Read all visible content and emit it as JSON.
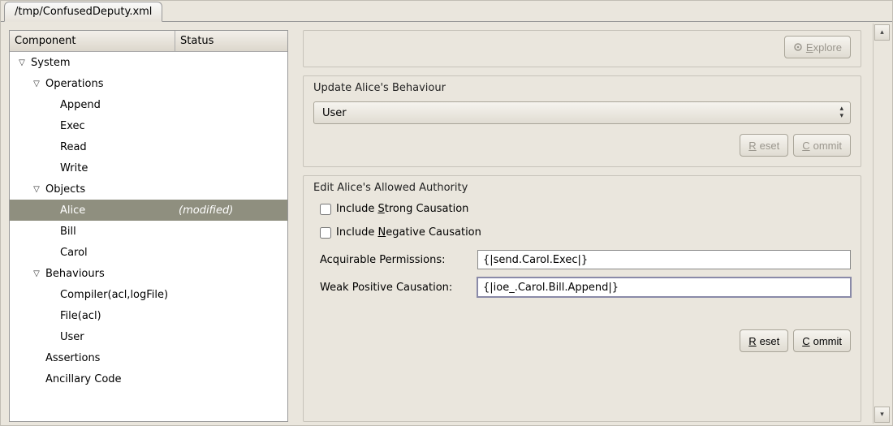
{
  "tab": {
    "title": "/tmp/ConfusedDeputy.xml"
  },
  "tree": {
    "columns": {
      "component": "Component",
      "status": "Status"
    },
    "rows": [
      {
        "indent": 0,
        "exp": true,
        "label": "System",
        "status": "",
        "selected": false
      },
      {
        "indent": 1,
        "exp": true,
        "label": "Operations",
        "status": "",
        "selected": false
      },
      {
        "indent": 2,
        "exp": null,
        "label": "Append",
        "status": "",
        "selected": false
      },
      {
        "indent": 2,
        "exp": null,
        "label": "Exec",
        "status": "",
        "selected": false
      },
      {
        "indent": 2,
        "exp": null,
        "label": "Read",
        "status": "",
        "selected": false
      },
      {
        "indent": 2,
        "exp": null,
        "label": "Write",
        "status": "",
        "selected": false
      },
      {
        "indent": 1,
        "exp": true,
        "label": "Objects",
        "status": "",
        "selected": false
      },
      {
        "indent": 2,
        "exp": null,
        "label": "Alice",
        "status": "(modified)",
        "selected": true
      },
      {
        "indent": 2,
        "exp": null,
        "label": "Bill",
        "status": "",
        "selected": false
      },
      {
        "indent": 2,
        "exp": null,
        "label": "Carol",
        "status": "",
        "selected": false
      },
      {
        "indent": 1,
        "exp": true,
        "label": "Behaviours",
        "status": "",
        "selected": false
      },
      {
        "indent": 2,
        "exp": null,
        "label": "Compiler(acl,logFile)",
        "status": "",
        "selected": false
      },
      {
        "indent": 2,
        "exp": null,
        "label": "File(acl)",
        "status": "",
        "selected": false
      },
      {
        "indent": 2,
        "exp": null,
        "label": "User",
        "status": "",
        "selected": false
      },
      {
        "indent": 1,
        "exp": null,
        "label": "Assertions",
        "status": "",
        "selected": false
      },
      {
        "indent": 1,
        "exp": null,
        "label": "Ancillary Code",
        "status": "",
        "selected": false
      }
    ]
  },
  "top_actions": {
    "explore": "Explore"
  },
  "behaviour": {
    "title": "Update Alice's Behaviour",
    "select_value": "User",
    "reset": "Reset",
    "commit": "Commit"
  },
  "authority": {
    "title": "Edit Alice's Allowed Authority",
    "strong_pre": "Include ",
    "strong_u": "S",
    "strong_post": "trong Causation",
    "negative_pre": "Include ",
    "negative_u": "N",
    "negative_post": "egative Causation",
    "acq_label": "Acquirable Permissions:",
    "acq_value": "{|send.Carol.Exec|}",
    "wpc_label": "Weak Positive Causation:",
    "wpc_value": "{|ioe_.Carol.Bill.Append|}",
    "reset_u": "R",
    "reset_post": "eset",
    "commit_u": "C",
    "commit_post": "ommit"
  }
}
